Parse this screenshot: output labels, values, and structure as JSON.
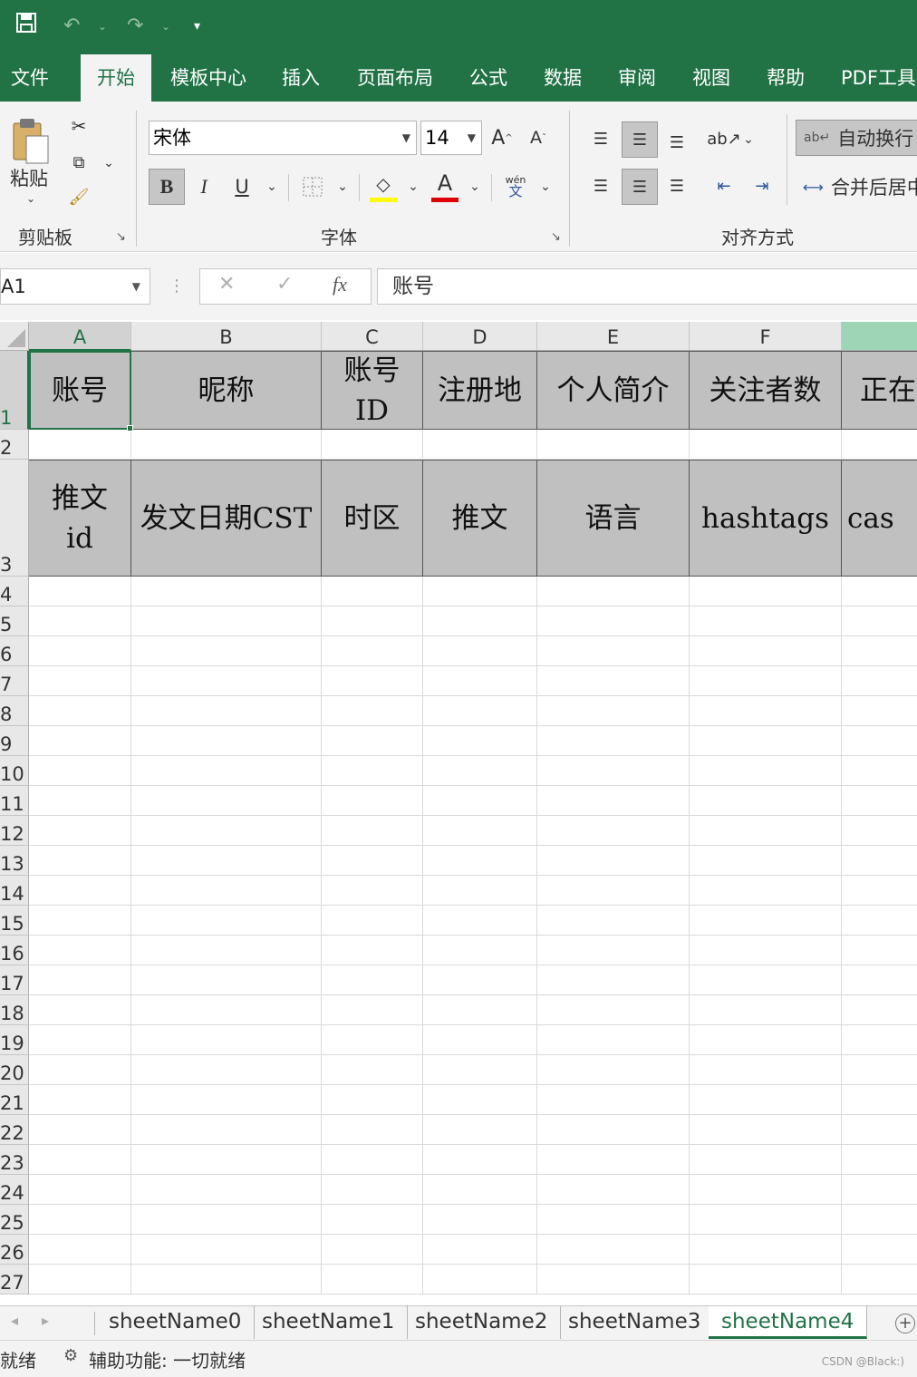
{
  "quick_access": {
    "save_icon": "save-icon",
    "undo_icon": "undo-icon",
    "redo_icon": "redo-icon",
    "customize_icon": "customize-qat-icon"
  },
  "ribbon_tabs": [
    {
      "label": "文件",
      "active": false
    },
    {
      "label": "开始",
      "active": true
    },
    {
      "label": "模板中心",
      "active": false
    },
    {
      "label": "插入",
      "active": false
    },
    {
      "label": "页面布局",
      "active": false
    },
    {
      "label": "公式",
      "active": false
    },
    {
      "label": "数据",
      "active": false
    },
    {
      "label": "审阅",
      "active": false
    },
    {
      "label": "视图",
      "active": false
    },
    {
      "label": "帮助",
      "active": false
    },
    {
      "label": "PDF工具",
      "active": false
    }
  ],
  "clipboard": {
    "paste_label": "粘贴",
    "group_label": "剪贴板"
  },
  "font": {
    "name": "宋体",
    "size": "14",
    "group_label": "字体",
    "bold": "B",
    "italic": "I",
    "underline": "U",
    "phonetic_top": "wén",
    "phonetic_bottom": "文"
  },
  "alignment": {
    "wrap_text": "自动换行",
    "merge_center": "合并后居中",
    "group_label": "对齐方式"
  },
  "formula_bar": {
    "name_box": "A1",
    "cancel": "✕",
    "enter": "✓",
    "fx": "fx",
    "content": "账号"
  },
  "columns": [
    "A",
    "B",
    "C",
    "D",
    "E",
    "F"
  ],
  "rows": [
    "1",
    "2",
    "3",
    "4",
    "5",
    "6",
    "7",
    "8",
    "9",
    "10",
    "11",
    "12",
    "13",
    "14",
    "15",
    "16",
    "17",
    "18",
    "19",
    "20",
    "21",
    "22",
    "23",
    "24",
    "25",
    "26",
    "27"
  ],
  "row1_cells": [
    "账号",
    "昵称",
    "账号\nID",
    "注册地",
    "个人简介",
    "关注者数",
    "正在"
  ],
  "row3_cells": [
    "推文\nid",
    "发文日期CST",
    "时区",
    "推文",
    "语言",
    "hashtags",
    "cas"
  ],
  "sheets": [
    {
      "name": "sheetName0",
      "active": false
    },
    {
      "name": "sheetName1",
      "active": false
    },
    {
      "name": "sheetName2",
      "active": false
    },
    {
      "name": "sheetName3",
      "active": false
    },
    {
      "name": "sheetName4",
      "active": true
    }
  ],
  "status": {
    "ready": "就绪",
    "accessibility": "辅助功能: 一切就绪",
    "watermark": "CSDN @Black:)"
  },
  "colors": {
    "accent": "#217346",
    "header_fill": "#c0c0c0",
    "font_color_bar": "#e00000",
    "fill_color_bar": "#ffff00"
  }
}
